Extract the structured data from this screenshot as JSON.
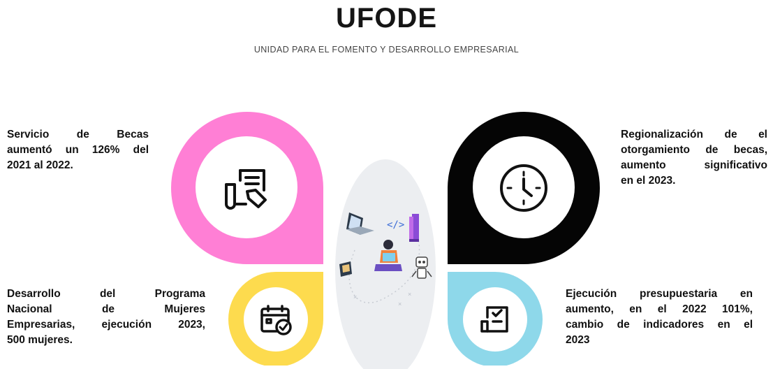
{
  "header": {
    "title": "UFODE",
    "subtitle": "UNIDAD PARA EL FOMENTO Y DESARROLLO EMPRESARIAL"
  },
  "blocks": {
    "top_left": [
      "Servicio de Becas",
      "aumentó un 126% del",
      "2021 al 2022."
    ],
    "top_right": [
      "Regionalización de el",
      "otorgamiento de becas,",
      "aumento significativo",
      "en el 2023."
    ],
    "bottom_left": [
      "Desarrollo del Programa",
      "Nacional de Mujeres",
      "Empresarias, ejecución 2023,",
      "500 mujeres."
    ],
    "bottom_right": [
      "Ejecución presupuestaria en",
      "aumento, en el 2022 101%,",
      "cambio de indicadores en el",
      "2023"
    ]
  },
  "colors": {
    "pink": "#ff7fd5",
    "black": "#050505",
    "yellow": "#fddb4e",
    "blue": "#8ed8ea",
    "oval": "#eceef1"
  },
  "icons": {
    "top_left": "scholarship-document-icon",
    "top_right": "clock-icon",
    "bottom_left": "calendar-check-icon",
    "bottom_right": "checklist-icon"
  }
}
